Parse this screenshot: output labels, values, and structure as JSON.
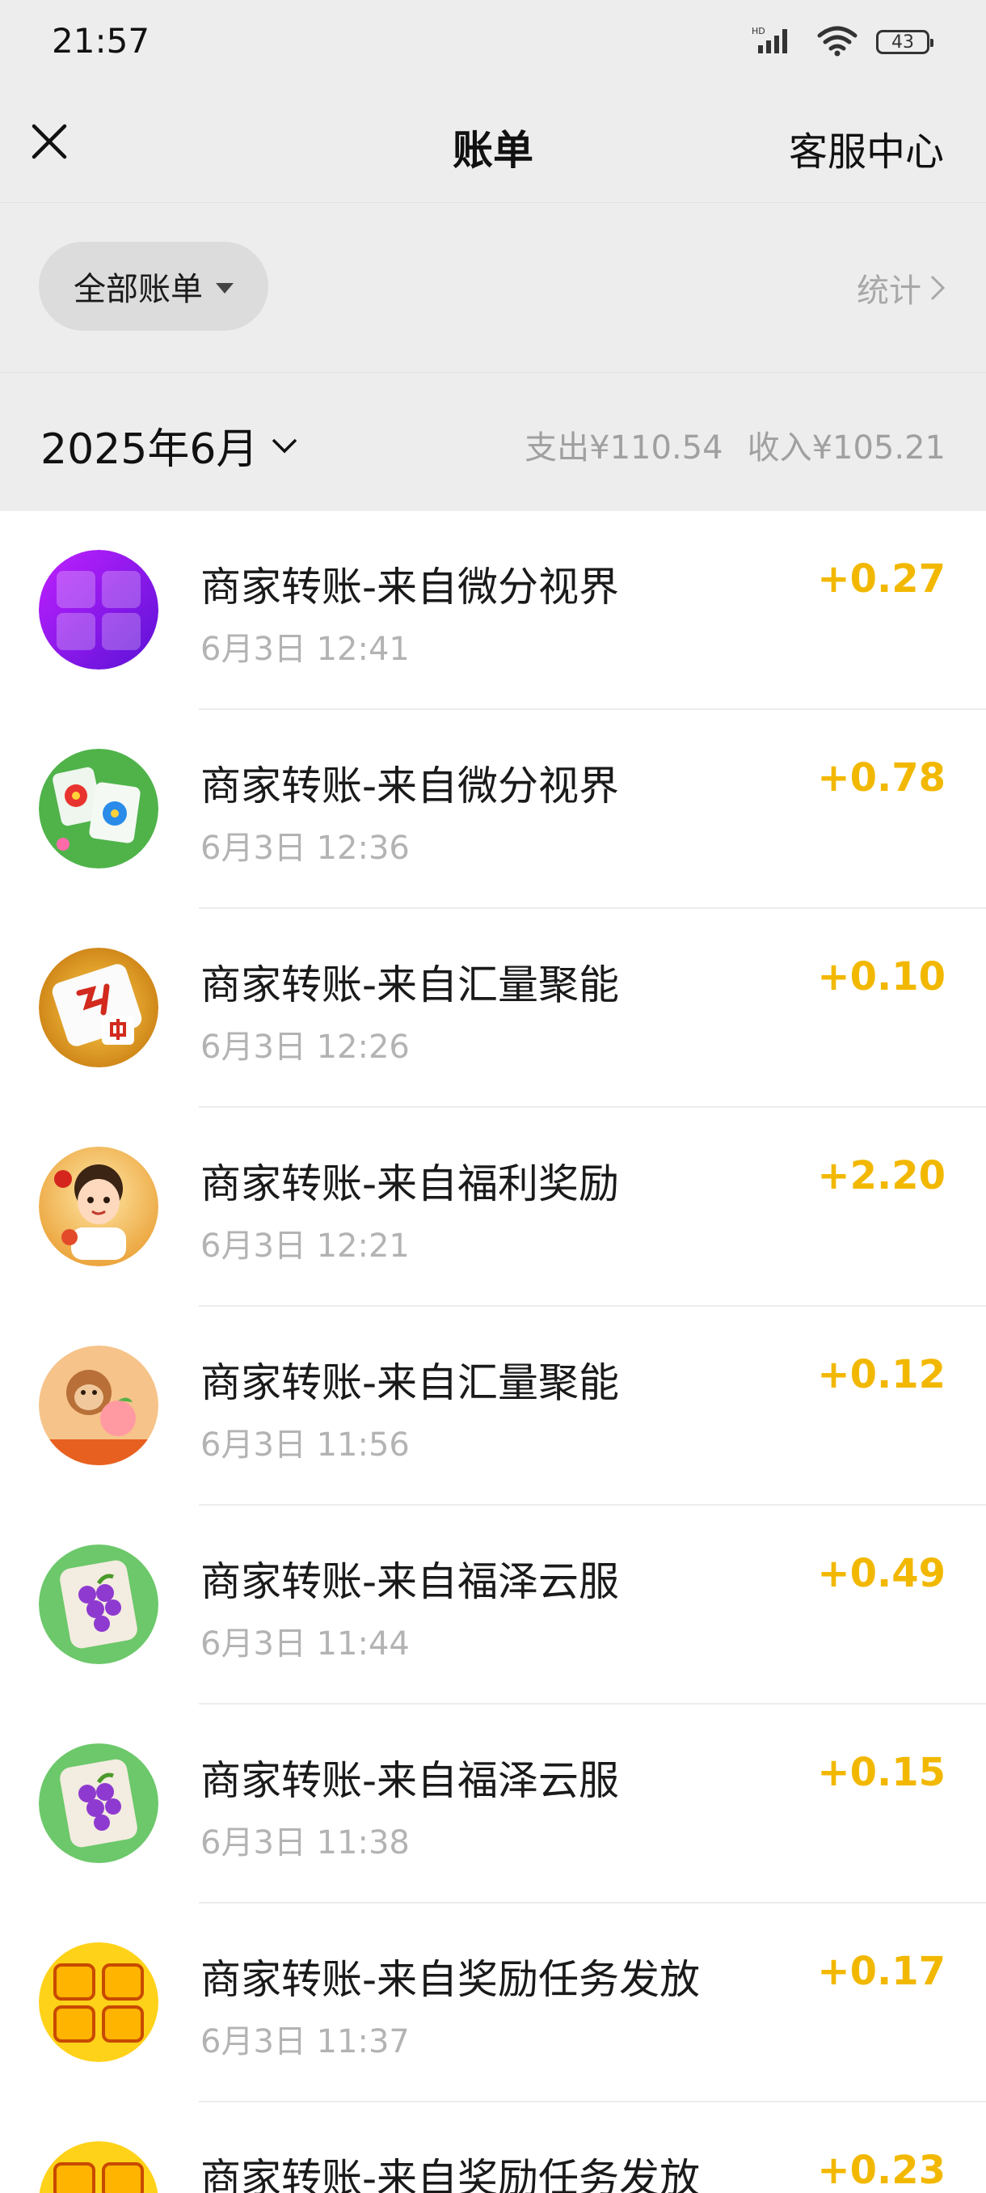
{
  "status_bar": {
    "time": "21:57",
    "battery": "43",
    "icons": [
      "hd-signal-icon",
      "wifi-icon",
      "battery-icon"
    ]
  },
  "header": {
    "close_icon": "close-icon",
    "title": "账单",
    "service_center": "客服中心"
  },
  "filter": {
    "all_bills": "全部账单",
    "stats": "统计"
  },
  "month": {
    "label": "2025年6月",
    "expense": "支出¥110.54",
    "income": "收入¥105.21"
  },
  "transactions": [
    {
      "title": "商家转账-来自微分视界",
      "time": "6月3日 12:41",
      "amount": "+0.27",
      "icon": "ni-chang-wo-cai-app-icon"
    },
    {
      "title": "商家转账-来自微分视界",
      "time": "6月3日 12:36",
      "amount": "+0.78",
      "icon": "flower-tile-app-icon"
    },
    {
      "title": "商家转账-来自汇量聚能",
      "time": "6月3日 12:26",
      "amount": "+0.10",
      "icon": "mahjong-tile-app-icon"
    },
    {
      "title": "商家转账-来自福利奖励",
      "time": "6月3日 12:21",
      "amount": "+2.20",
      "icon": "cartoon-girl-app-icon"
    },
    {
      "title": "商家转账-来自汇量聚能",
      "time": "6月3日 11:56",
      "amount": "+0.12",
      "icon": "monkey-peach-app-icon"
    },
    {
      "title": "商家转账-来自福泽云服",
      "time": "6月3日 11:44",
      "amount": "+0.49",
      "icon": "grape-tile-app-icon"
    },
    {
      "title": "商家转账-来自福泽云服",
      "time": "6月3日 11:38",
      "amount": "+0.15",
      "icon": "grape-tile-app-icon"
    },
    {
      "title": "商家转账-来自奖励任务发放",
      "time": "6月3日 11:37",
      "amount": "+0.17",
      "icon": "yellow-text-app-icon"
    },
    {
      "title": "商家转账-来自奖励任务发放",
      "time": "",
      "amount": "+0.23",
      "icon": "yellow-text-app-icon"
    }
  ],
  "colors": {
    "amount": "#f2b800",
    "header_bg": "#ededed",
    "secondary_text": "#b3b3b3"
  }
}
